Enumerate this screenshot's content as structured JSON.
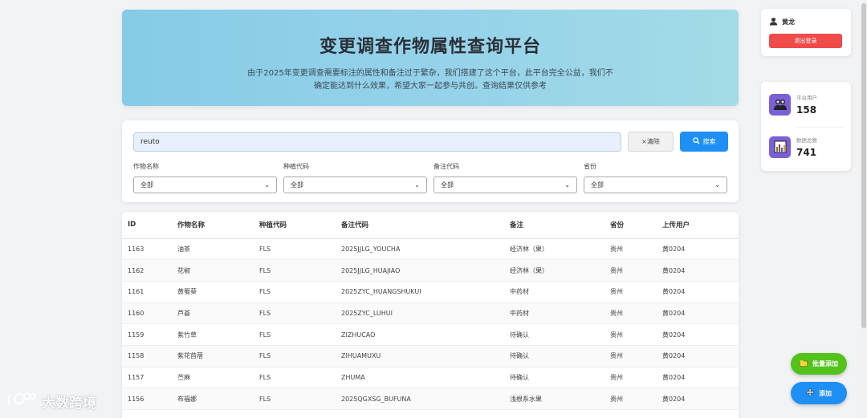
{
  "header": {
    "title": "变更调查作物属性查询平台",
    "description": "由于2025年变更调查需要标注的属性和备注过于繁杂，我们搭建了这个平台，此平台完全公益，我们不确定能达到什么效果，希望大家一起参与共创。查询结果仅供参考"
  },
  "search": {
    "value": "reuto",
    "clear_label": "×清除",
    "search_label": "搜索",
    "filters": [
      {
        "label": "作物名称",
        "selected": "全部"
      },
      {
        "label": "种植代码",
        "selected": "全部"
      },
      {
        "label": "备注代码",
        "selected": "全部"
      },
      {
        "label": "省份",
        "selected": "全部"
      }
    ]
  },
  "table": {
    "columns": [
      "ID",
      "作物名称",
      "种植代码",
      "备注代码",
      "备注",
      "省份",
      "上传用户"
    ],
    "rows": [
      [
        "1163",
        "油茶",
        "FLS",
        "2025JJLG_YOUCHA",
        "经济林（果）",
        "贵州",
        "黄0204"
      ],
      [
        "1162",
        "花椒",
        "FLS",
        "2025JJLG_HUAJIAO",
        "经济林（果）",
        "贵州",
        "黄0204"
      ],
      [
        "1161",
        "黄蜀葵",
        "FLS",
        "2025ZYC_HUANGSHUKUI",
        "中药材",
        "贵州",
        "黄0204"
      ],
      [
        "1160",
        "芦荟",
        "FLS",
        "2025ZYC_LUHUI",
        "中药材",
        "贵州",
        "黄0204"
      ],
      [
        "1159",
        "紫竹草",
        "FLS",
        "ZIZHUCAO",
        "待确认",
        "贵州",
        "黄0204"
      ],
      [
        "1158",
        "紫花苜蓿",
        "FLS",
        "ZIHUAMUXU",
        "待确认",
        "贵州",
        "黄0204"
      ],
      [
        "1157",
        "苎麻",
        "FLS",
        "ZHUMA",
        "待确认",
        "贵州",
        "黄0204"
      ],
      [
        "1156",
        "布福娜",
        "FLS",
        "2025QGXSG_BUFUNA",
        "浅根系水果",
        "贵州",
        "黄0204"
      ],
      [
        "",
        "",
        "",
        "",
        "",
        "",
        ""
      ]
    ]
  },
  "user": {
    "name": "黄龙",
    "logout_label": "退出登录"
  },
  "stats": {
    "users_label": "平台用户",
    "users_value": "158",
    "records_label": "数据总数",
    "records_value": "741"
  },
  "actions": {
    "batch_add_label": "批量添加",
    "add_label": "添加"
  },
  "watermark": {
    "text": "大数跨境"
  },
  "colors": {
    "primary": "#1e90f5",
    "danger": "#f04b4b",
    "success": "#53c21b",
    "stat_icon": "#7b5fd6"
  }
}
